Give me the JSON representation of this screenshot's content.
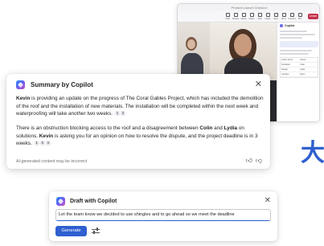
{
  "teams_window": {
    "title": "Product Launch Check-in",
    "toolbar_items": [
      "Chat",
      "People",
      "Raise",
      "React",
      "View",
      "Notes",
      "Apps",
      "More",
      "Camera",
      "Mic",
      "Share"
    ],
    "leave_label": "Leave",
    "copilot_panel": {
      "header": "Copilot",
      "table_rows": [
        [
          "Action Items",
          "Owner"
        ],
        [
          "Schedule",
          "Colin"
        ],
        [
          "Design",
          "Lydia"
        ],
        [
          "Vendors",
          "Kevin"
        ]
      ]
    }
  },
  "summary": {
    "title": "Summary by Copilot",
    "p1": {
      "name1": "Kevin",
      "text1": " is providing an update on the progress of  The Coral Gables Project, which has included the demolition of the roof and the installation of new materials. The installation will be completed within the next week and waterproofing will take another two weeks.",
      "cites": [
        "1",
        "2"
      ]
    },
    "p2": {
      "text1": "There is an obstruction blocking access to the roof and a disagreement between ",
      "name1": "Colin",
      "text2": " and ",
      "name2": "Lydia",
      "text3": " on solutions. ",
      "name3": "Kevin",
      "text4": " is asking you for an opinion on how to resolve the dispute, and the project deadline is in 3 weeks.",
      "cites": [
        "1",
        "3",
        "4"
      ]
    },
    "footer": "AI-generated content may be incorrect"
  },
  "big_char": "大",
  "draft": {
    "title": "Draft with Copilot",
    "input_value": "Let the team know we decided to use shingles and to go ahead so we meet the deadline",
    "generate_label": "Generate"
  },
  "colors": {
    "accent": "#2f5fd0",
    "leave": "#c4314b"
  }
}
